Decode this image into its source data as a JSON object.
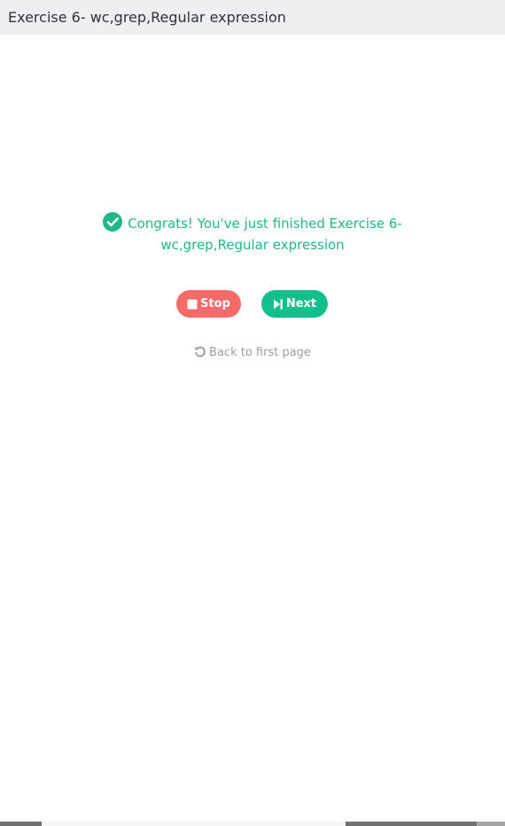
{
  "header": {
    "title": "Exercise 6- wc,grep,Regular expression"
  },
  "result": {
    "icon": "check-circle-icon",
    "message_line1": "Congrats! You've just finished Exercise 6-",
    "message_line2": "wc,grep,Regular expression",
    "color": "#1fb789"
  },
  "actions": {
    "stop_label": "Stop",
    "stop_icon": "stop-square-icon",
    "stop_color": "#f76a6a",
    "next_label": "Next",
    "next_icon": "step-forward-icon",
    "next_color": "#15bf8d"
  },
  "back": {
    "label": "Back to first page",
    "icon": "undo-icon"
  }
}
